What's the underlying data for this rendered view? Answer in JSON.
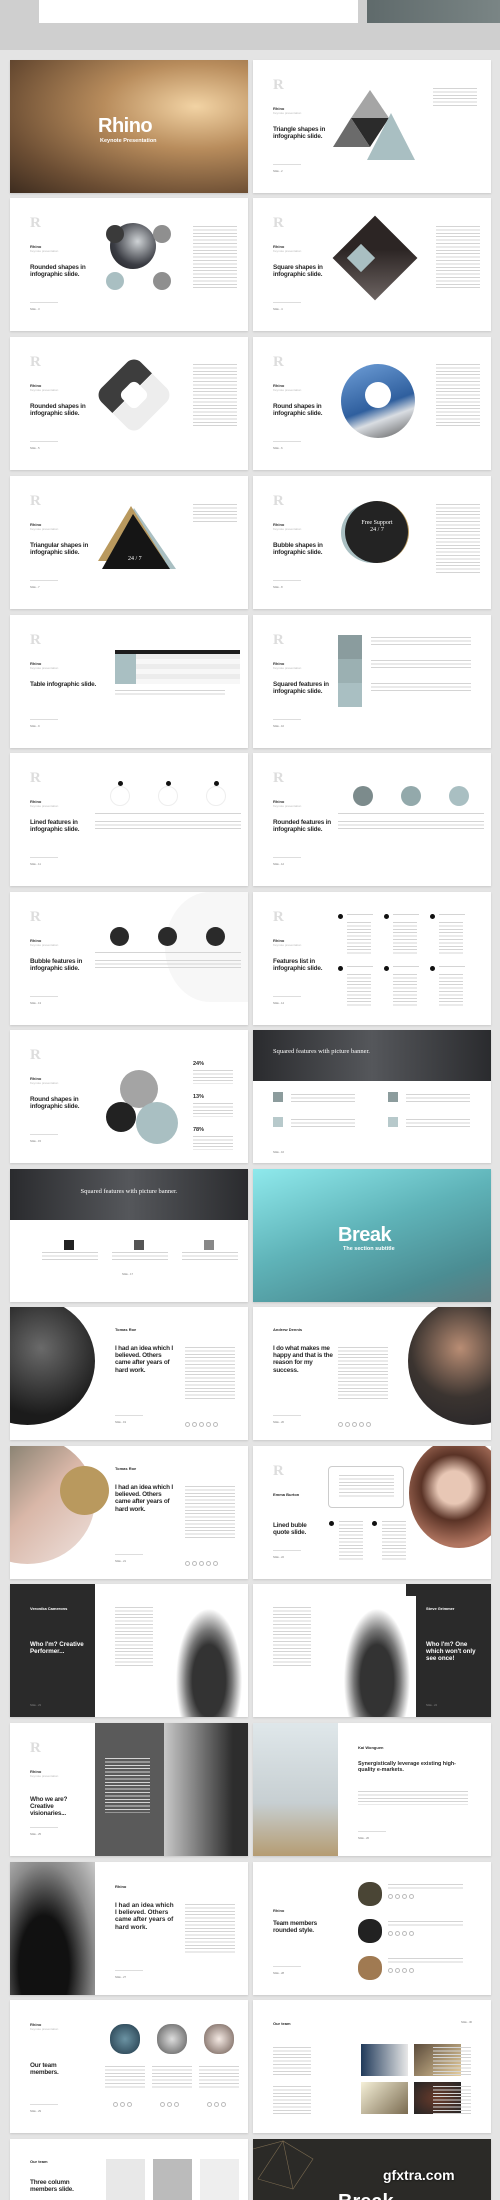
{
  "brand": {
    "name": "Rhino",
    "tagline": "Keynote presentation"
  },
  "colors": {
    "accent": "#a9bfc2",
    "dark": "#262626",
    "gold": "#b9995e",
    "gray": "#9b9b9b",
    "teal": "#5fb3b8"
  },
  "slides": [
    {
      "layout": "cover",
      "title": "Rhino",
      "subtitle": "Keynote Presentation"
    },
    {
      "layout": "std",
      "title": "Triangle shapes in infographic slide.",
      "visual": "triangles",
      "slide_no": "Slide - 2"
    },
    {
      "layout": "std",
      "title": "Rounded shapes in infographic slide.",
      "visual": "circles4",
      "slide_no": "Slide - 3"
    },
    {
      "layout": "std",
      "title": "Square shapes in infographic slide.",
      "visual": "diamond",
      "slide_no": "Slide - 4"
    },
    {
      "layout": "std",
      "title": "Rounded shapes in infographic slide.",
      "visual": "rdiamond",
      "slide_no": "Slide - 5"
    },
    {
      "layout": "std",
      "title": "Round shapes in infographic slide.",
      "visual": "photocircle",
      "slide_no": "Slide - 6"
    },
    {
      "layout": "std",
      "title": "Triangular shapes in infographic slide.",
      "visual": "triangle247",
      "visual_text": "24 / 7",
      "slide_no": "Slide - 7"
    },
    {
      "layout": "std",
      "title": "Bubble shapes in infographic slide.",
      "visual": "bubble",
      "visual_text": "Free Support 24 / 7",
      "slide_no": "Slide - 8"
    },
    {
      "layout": "std",
      "title": "Table infographic slide.",
      "visual": "table",
      "slide_no": "Slide - 9"
    },
    {
      "layout": "std",
      "title": "Squared features in infographic slide.",
      "visual": "squares",
      "slide_no": "Slide - 10"
    },
    {
      "layout": "std",
      "title": "Lined features in infographic slide.",
      "visual": "icons-lined",
      "slide_no": "Slide - 11"
    },
    {
      "layout": "std",
      "title": "Rounded features in infographic slide.",
      "visual": "icons-rounded",
      "slide_no": "Slide - 12"
    },
    {
      "layout": "std",
      "title": "Bubble features in infographic slide.",
      "visual": "icons-bubble",
      "slide_no": "Slide - 13"
    },
    {
      "layout": "std",
      "title": "Features list in infographic slide.",
      "visual": "list6",
      "slide_no": "Slide - 14"
    },
    {
      "layout": "std",
      "title": "Round shapes in infographic slide.",
      "visual": "venn",
      "stats": [
        "24%",
        "13%",
        "78%"
      ],
      "slide_no": "Slide - 15"
    },
    {
      "layout": "banner",
      "title": "Squared features with picture banner.",
      "align": "left",
      "slide_no": "Slide - 16"
    },
    {
      "layout": "banner",
      "title": "Squared features with picture banner.",
      "align": "center",
      "slide_no": "Slide - 17"
    },
    {
      "layout": "break",
      "title": "Break",
      "subtitle": "The section subtitle"
    },
    {
      "layout": "profile",
      "photo": "left",
      "name": "Tomas Roe",
      "quote": "I had an idea which I believed. Others came after years of hard work.",
      "slide_no": "Slide - 19"
    },
    {
      "layout": "profile",
      "photo": "right",
      "name": "Andrew Dennis",
      "quote": "I do what makes me happy and that is the reason for my success.",
      "slide_no": "Slide - 20"
    },
    {
      "layout": "profile",
      "photo": "left-gold",
      "name": "Tomas Roe",
      "quote": "I had an idea which I believed. Others came after years of hard work.",
      "slide_no": "Slide - 21"
    },
    {
      "layout": "bubblequote",
      "name": "Emma Burton",
      "title": "Lined buble quote slide.",
      "slide_no": "Slide - 22"
    },
    {
      "layout": "darkpanel",
      "side": "left",
      "name": "Veronika Camerons",
      "quote": "Who I'm? Creative Performer...",
      "slide_no": "Slide - 23"
    },
    {
      "layout": "darkpanel",
      "side": "right",
      "name": "Steve Grimmer",
      "quote": "Who I'm? One which won't only see once!",
      "slide_no": "Slide - 24"
    },
    {
      "layout": "split",
      "title": "Who we are? Creative visionaries...",
      "slide_no": "Slide - 25"
    },
    {
      "layout": "photoquote",
      "tone": "light",
      "name": "Kai Wonguen",
      "quote": "Synergistically leverage existing high-quality e-markets.",
      "slide_no": "Slide - 26"
    },
    {
      "layout": "photoquote",
      "tone": "dark",
      "name": "Rhino",
      "quote": "I had an idea which I believed. Others came after years of hard work.",
      "slide_no": "Slide - 27"
    },
    {
      "layout": "team-rounded",
      "title": "Team members rounded style.",
      "slide_no": "Slide - 28"
    },
    {
      "layout": "team3",
      "title": "Our team members.",
      "slide_no": "Slide - 29"
    },
    {
      "layout": "teamgrid",
      "title": "Our team",
      "slide_no": "Slide - 30"
    },
    {
      "layout": "teamcols",
      "title": "Our team",
      "subtitle": "Three column members slide."
    },
    {
      "layout": "darkbreak",
      "title": "Break",
      "watermark": "gfxtra.com"
    }
  ]
}
